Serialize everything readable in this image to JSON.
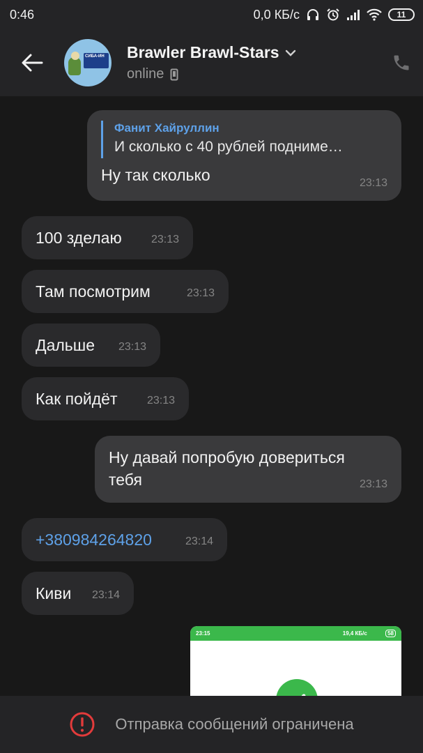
{
  "status_bar": {
    "time": "0:46",
    "speed": "0,0 КБ/с",
    "battery": "11"
  },
  "header": {
    "title": "Brawler Brawl-Stars",
    "status": "online",
    "avatar_text": "СИБА-ИН"
  },
  "messages": [
    {
      "id": "m1",
      "direction": "out",
      "reply_name": "Фанит Хайруллин",
      "reply_text": "И сколько с 40 рублей подниме…",
      "text": "Ну так сколько",
      "time": "23:13"
    },
    {
      "id": "m2",
      "direction": "in",
      "text": "100 зделаю",
      "time": "23:13"
    },
    {
      "id": "m3",
      "direction": "in",
      "text": "Там посмотрим",
      "time": "23:13"
    },
    {
      "id": "m4",
      "direction": "in",
      "text": "Дальше",
      "time": "23:13"
    },
    {
      "id": "m5",
      "direction": "in",
      "text": "Как пойдёт",
      "time": "23:13"
    },
    {
      "id": "m6",
      "direction": "out",
      "text_line1": "Ну давай попробую довериться",
      "text_line2": "тебя",
      "time": "23:13"
    },
    {
      "id": "m7",
      "direction": "in",
      "text": "+380984264820",
      "time": "23:14"
    },
    {
      "id": "m8",
      "direction": "in",
      "text": "Киви",
      "time": "23:14"
    }
  ],
  "attachment": {
    "status_time": "23:15",
    "status_speed": "19,4 КБ/с",
    "status_battery": "58"
  },
  "bottom_bar": {
    "text": "Отправка сообщений ограничена"
  },
  "colors": {
    "background": "#181818",
    "bar": "#242426",
    "bubble_in": "#2a2a2c",
    "bubble_out": "#3a3a3c",
    "accent": "#5ea1e8",
    "alert": "#e23b3b",
    "success": "#3bb84b"
  },
  "icons": [
    "back-arrow-icon",
    "chevron-down-icon",
    "mobile-device-icon",
    "phone-icon",
    "headphones-icon",
    "alarm-icon",
    "signal-icon",
    "wifi-icon",
    "battery-icon",
    "alert-circle-icon",
    "checkmark-icon"
  ]
}
